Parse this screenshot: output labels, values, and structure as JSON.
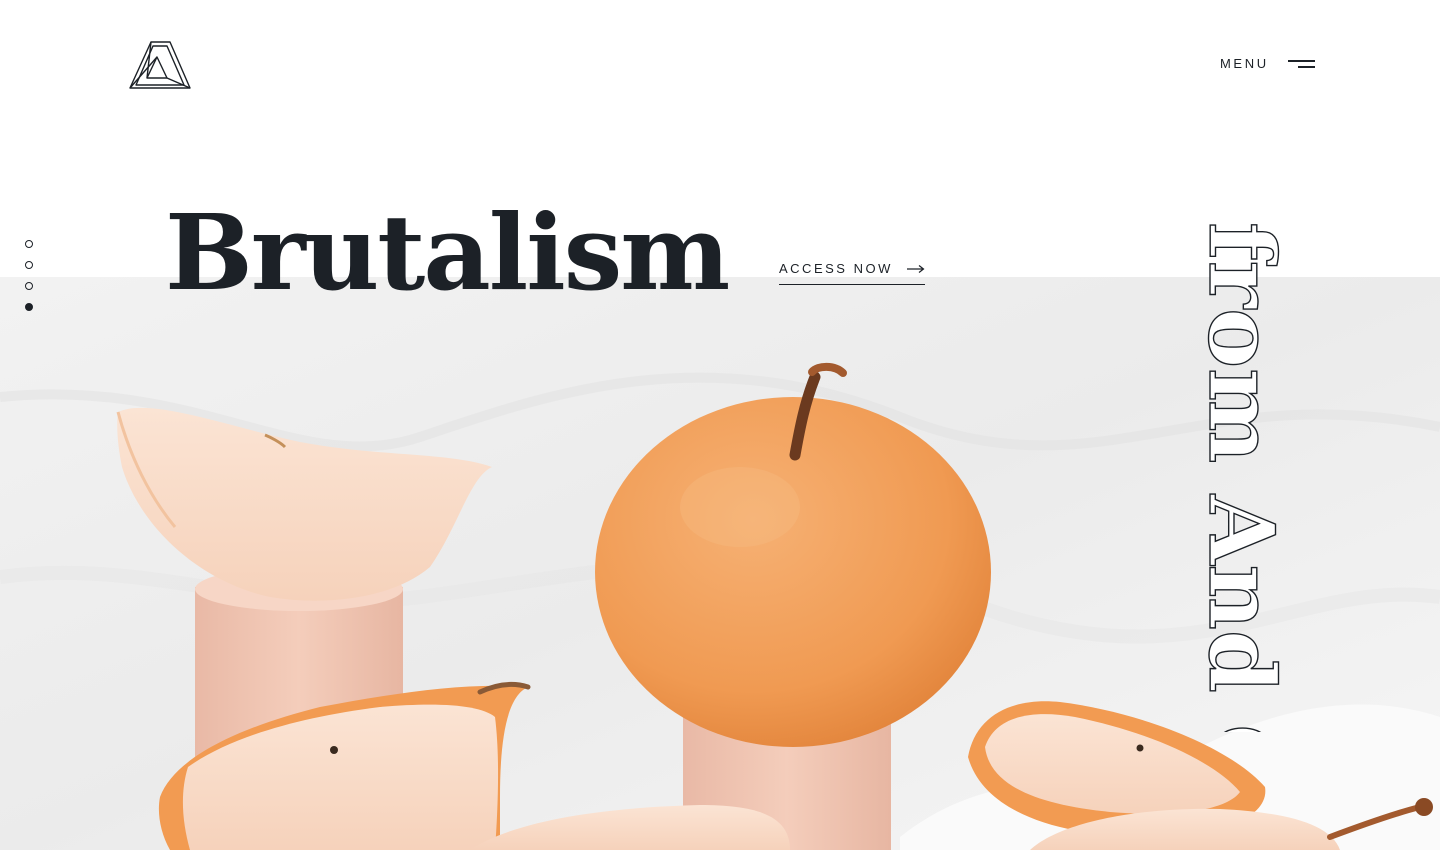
{
  "header": {
    "logo_icon": "triangle-logo",
    "menu_label": "MENU",
    "menu_icon": "hamburger-icon"
  },
  "hero": {
    "headline": "Brutalism",
    "cta_label": "ACCESS NOW",
    "cta_icon": "long-arrow-right-icon",
    "vertical_text": "from And Co",
    "image_description": "orange pears and sliced pear pieces on wooden cylinder blocks against white fabric"
  },
  "slider": {
    "dots": 4,
    "active_index": 3
  },
  "colors": {
    "text": "#1c2127",
    "background": "#ffffff",
    "pear": "#f09a52"
  }
}
